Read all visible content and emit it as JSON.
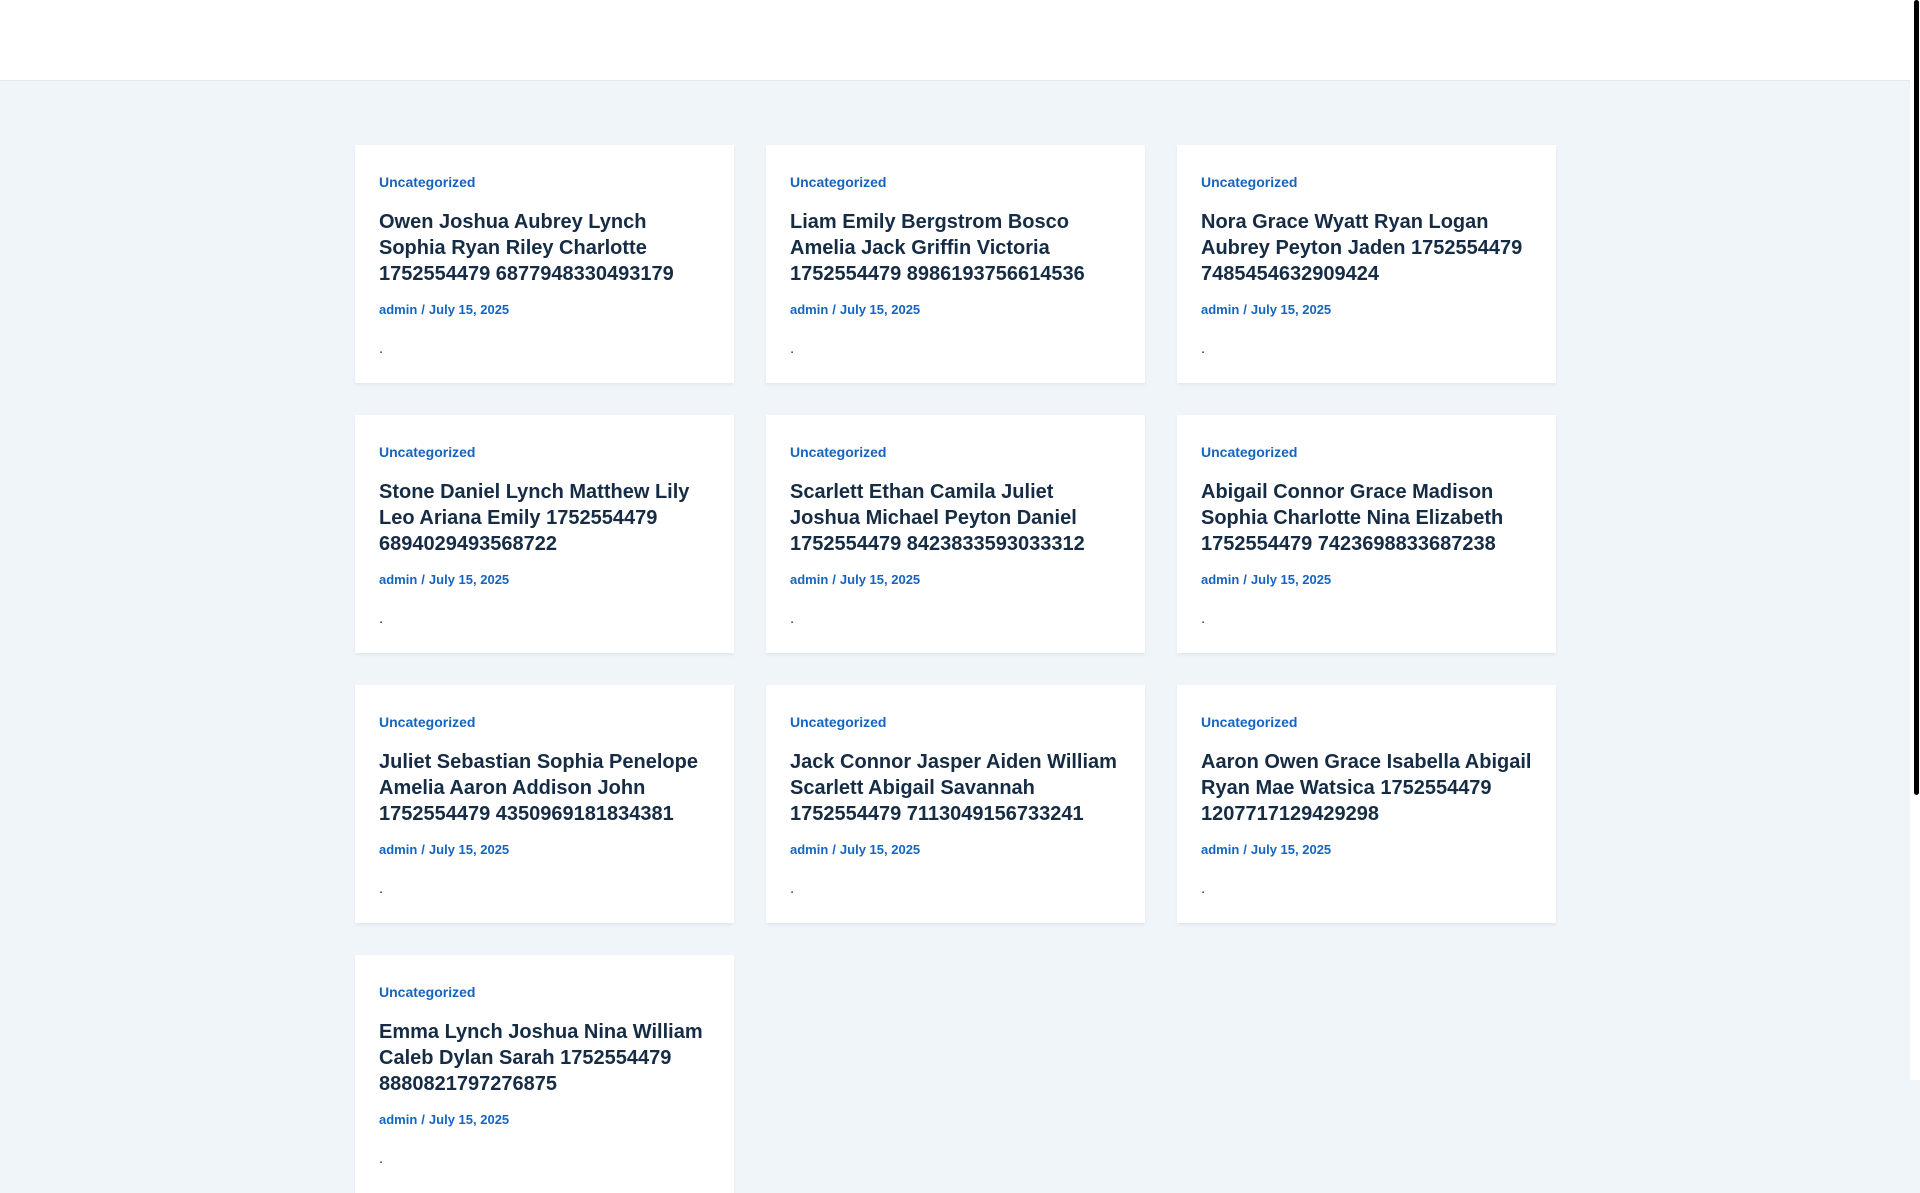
{
  "posts": [
    {
      "category": "Uncategorized",
      "title": "Owen Joshua Aubrey Lynch Sophia Ryan Riley Charlotte 1752554479 6877948330493179",
      "author": "admin",
      "separator": "/",
      "date": "July 15, 2025",
      "excerpt": "."
    },
    {
      "category": "Uncategorized",
      "title": "Liam Emily Bergstrom Bosco Amelia Jack Griffin Victoria 1752554479 8986193756614536",
      "author": "admin",
      "separator": "/",
      "date": "July 15, 2025",
      "excerpt": "."
    },
    {
      "category": "Uncategorized",
      "title": "Nora Grace Wyatt Ryan Logan Aubrey Peyton Jaden 1752554479 7485454632909424",
      "author": "admin",
      "separator": "/",
      "date": "July 15, 2025",
      "excerpt": "."
    },
    {
      "category": "Uncategorized",
      "title": "Stone Daniel Lynch Matthew Lily Leo Ariana Emily 1752554479 6894029493568722",
      "author": "admin",
      "separator": "/",
      "date": "July 15, 2025",
      "excerpt": "."
    },
    {
      "category": "Uncategorized",
      "title": "Scarlett Ethan Camila Juliet Joshua Michael Peyton Daniel 1752554479 8423833593033312",
      "author": "admin",
      "separator": "/",
      "date": "July 15, 2025",
      "excerpt": "."
    },
    {
      "category": "Uncategorized",
      "title": "Abigail Connor Grace Madison Sophia Charlotte Nina Elizabeth 1752554479 7423698833687238",
      "author": "admin",
      "separator": "/",
      "date": "July 15, 2025",
      "excerpt": "."
    },
    {
      "category": "Uncategorized",
      "title": "Juliet Sebastian Sophia Penelope Amelia Aaron Addison John 1752554479 4350969181834381",
      "author": "admin",
      "separator": "/",
      "date": "July 15, 2025",
      "excerpt": "."
    },
    {
      "category": "Uncategorized",
      "title": "Jack Connor Jasper Aiden William Scarlett Abigail Savannah 1752554479 7113049156733241",
      "author": "admin",
      "separator": "/",
      "date": "July 15, 2025",
      "excerpt": "."
    },
    {
      "category": "Uncategorized",
      "title": "Aaron Owen Grace Isabella Abigail Ryan Mae Watsica 1752554479 1207717129429298",
      "author": "admin",
      "separator": "/",
      "date": "July 15, 2025",
      "excerpt": "."
    },
    {
      "category": "Uncategorized",
      "title": "Emma Lynch Joshua Nina William Caleb Dylan Sarah 1752554479 8880821797276875",
      "author": "admin",
      "separator": "/",
      "date": "July 15, 2025",
      "excerpt": "."
    }
  ]
}
